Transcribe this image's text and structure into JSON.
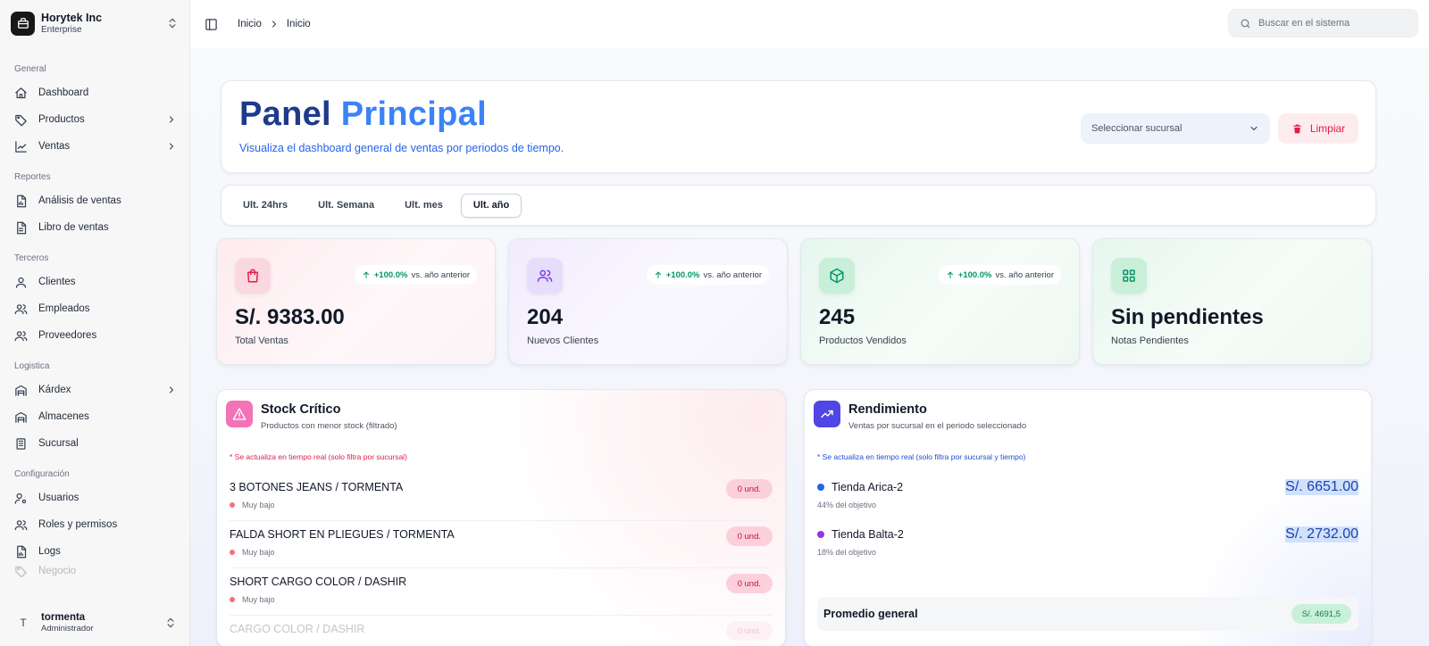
{
  "org": {
    "name": "Horytek Inc",
    "plan": "Enterprise"
  },
  "sidebar": {
    "sections": [
      {
        "title": "General",
        "items": [
          {
            "label": "Dashboard",
            "icon": "home-icon",
            "chevron": false
          },
          {
            "label": "Productos",
            "icon": "tag-icon",
            "chevron": true
          },
          {
            "label": "Ventas",
            "icon": "chart-line-icon",
            "chevron": true
          }
        ]
      },
      {
        "title": "Reportes",
        "items": [
          {
            "label": "Análisis de ventas",
            "icon": "file-chart-icon",
            "chevron": false
          },
          {
            "label": "Libro de ventas",
            "icon": "file-text-icon",
            "chevron": false
          }
        ]
      },
      {
        "title": "Terceros",
        "items": [
          {
            "label": "Clientes",
            "icon": "user-icon",
            "chevron": false
          },
          {
            "label": "Empleados",
            "icon": "users-icon",
            "chevron": false
          },
          {
            "label": "Proveedores",
            "icon": "users-icon",
            "chevron": false
          }
        ]
      },
      {
        "title": "Logistica",
        "items": [
          {
            "label": "Kárdex",
            "icon": "warehouse-icon",
            "chevron": true
          },
          {
            "label": "Almacenes",
            "icon": "warehouse-icon",
            "chevron": false
          },
          {
            "label": "Sucursal",
            "icon": "building-icon",
            "chevron": false
          }
        ]
      },
      {
        "title": "Configuración",
        "items": [
          {
            "label": "Usuarios",
            "icon": "user-cog-icon",
            "chevron": false
          },
          {
            "label": "Roles y permisos",
            "icon": "users-icon",
            "chevron": false
          },
          {
            "label": "Logs",
            "icon": "file-chart-icon",
            "chevron": false
          }
        ]
      }
    ],
    "faded_item": "Negocio"
  },
  "user": {
    "initial": "T",
    "name": "tormenta",
    "role": "Administrador"
  },
  "topbar": {
    "breadcrumb": [
      "Inicio",
      "Inicio"
    ],
    "search_placeholder": "Buscar en el sistema"
  },
  "hero": {
    "title_part1": "Panel",
    "title_part2": "Principal",
    "subtitle": "Visualiza el dashboard general de ventas por periodos de tiempo.",
    "branch_select": "Seleccionar sucursal",
    "clear_label": "Limpiar"
  },
  "periods": {
    "tabs": [
      "Ult. 24hrs",
      "Ult. Semana",
      "Ult. mes",
      "Ult. año"
    ],
    "active": "Ult. año"
  },
  "stats": [
    {
      "value": "S/. 9383.00",
      "label": "Total Ventas",
      "delta": "+100.0%",
      "delta_suffix": "vs. año anterior",
      "icon": "shopping-bag-icon",
      "color": "#e11d48"
    },
    {
      "value": "204",
      "label": "Nuevos Clientes",
      "delta": "+100.0%",
      "delta_suffix": "vs. año anterior",
      "icon": "users-icon",
      "color": "#7c3aed"
    },
    {
      "value": "245",
      "label": "Productos Vendidos",
      "delta": "+100.0%",
      "delta_suffix": "vs. año anterior",
      "icon": "box-icon",
      "color": "#059669"
    },
    {
      "value": "Sin pendientes",
      "label": "Notas Pendientes",
      "icon": "grid-icon",
      "color": "#059669"
    }
  ],
  "stock": {
    "title": "Stock Crítico",
    "subtitle": "Productos con menor stock (filtrado)",
    "note": "* Se actualiza en tiempo real (solo filtra por sucursal)",
    "items": [
      {
        "name": "3 BOTONES JEANS / TORMENTA",
        "level": "Muy bajo",
        "qty": "0 und."
      },
      {
        "name": "FALDA SHORT EN PLIEGUES / TORMENTA",
        "level": "Muy bajo",
        "qty": "0 und."
      },
      {
        "name": "SHORT CARGO COLOR / DASHIR",
        "level": "Muy bajo",
        "qty": "0 und."
      },
      {
        "name": "CARGO COLOR / DASHIR",
        "level": "",
        "qty": "0 und."
      }
    ]
  },
  "performance": {
    "title": "Rendimiento",
    "subtitle": "Ventas por sucursal en el periodo seleccionado",
    "note": "* Se actualiza en tiempo real (solo filtra por sucursal y tiempo)",
    "items": [
      {
        "name": "Tienda Arica-2",
        "goal": "44% del objetivo",
        "amount": "S/. 6651.00",
        "color": "#2563eb"
      },
      {
        "name": "Tienda Balta-2",
        "goal": "18% del objetivo",
        "amount": "S/. 2732.00",
        "color": "#9333ea"
      }
    ],
    "average_label": "Promedio general",
    "average_value": "S/. 4691,5"
  },
  "colors": {
    "primary": "#2563eb",
    "danger": "#e11d48",
    "success": "#059669"
  }
}
